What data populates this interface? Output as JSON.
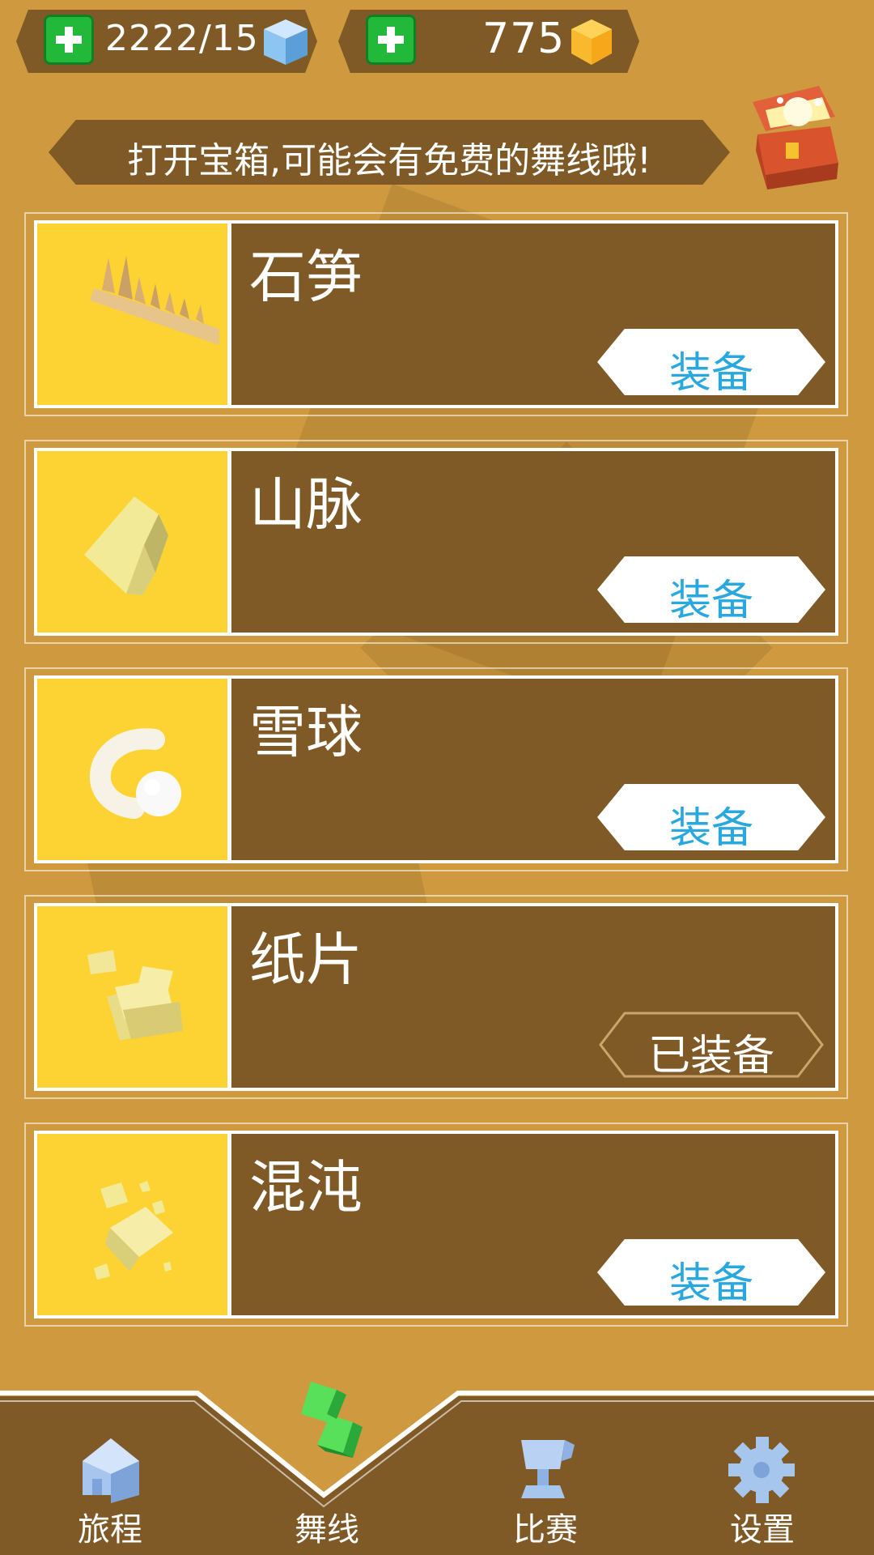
{
  "resources": {
    "energy": {
      "value": "2222/15",
      "icon": "blue-cube-icon"
    },
    "coins": {
      "value": "775",
      "icon": "gold-gem-icon"
    }
  },
  "banner": {
    "text": "打开宝箱,可能会有免费的舞线哦!"
  },
  "lines": [
    {
      "name": "石笋",
      "action": "装备",
      "equipped": false,
      "icon": "stalagmite-icon"
    },
    {
      "name": "山脉",
      "action": "装备",
      "equipped": false,
      "icon": "mountain-icon"
    },
    {
      "name": "雪球",
      "action": "装备",
      "equipped": false,
      "icon": "snowball-icon"
    },
    {
      "name": "纸片",
      "action": "已装备",
      "equipped": true,
      "icon": "paper-icon"
    },
    {
      "name": "混沌",
      "action": "装备",
      "equipped": false,
      "icon": "chaos-icon"
    }
  ],
  "nav": [
    {
      "label": "旅程",
      "icon": "house-icon",
      "active": false
    },
    {
      "label": "舞线",
      "icon": "dance-line-icon",
      "active": true
    },
    {
      "label": "比赛",
      "icon": "trophy-icon",
      "active": false
    },
    {
      "label": "设置",
      "icon": "gear-icon",
      "active": false
    }
  ],
  "colors": {
    "background": "#cf9a3f",
    "panel": "#7f5a27",
    "thumb": "#fdd333",
    "button_text": "#29a8e0",
    "plus": "#22b83a"
  }
}
